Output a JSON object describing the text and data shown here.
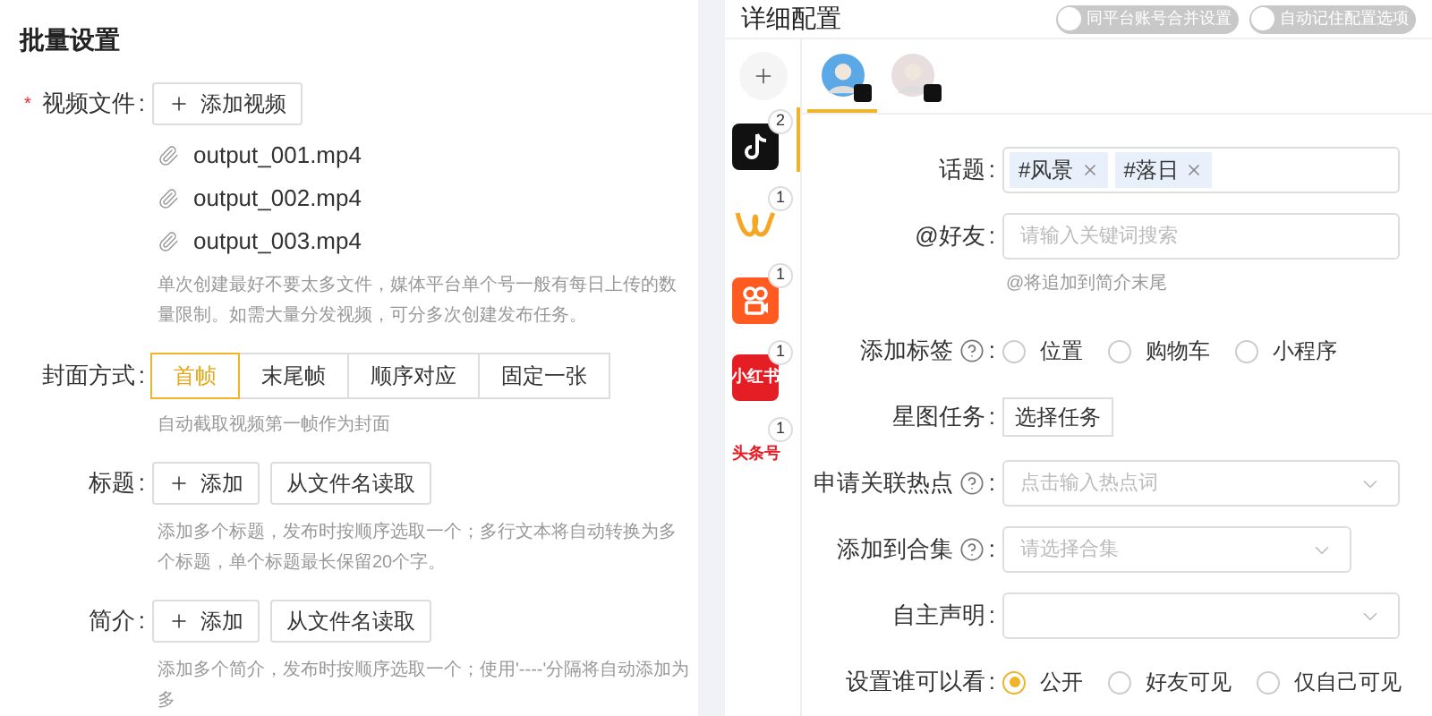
{
  "batch": {
    "title": "批量设置",
    "video": {
      "label": "视频文件",
      "colon": ":",
      "required_mark": "*",
      "button": "添加视频",
      "files": [
        "output_001.mp4",
        "output_002.mp4",
        "output_003.mp4"
      ],
      "hint": "单次创建最好不要太多文件，媒体平台单个号一般有每日上传的数量限制。如需大量分发视频，可分多次创建发布任务。"
    },
    "cover": {
      "label": "封面方式",
      "colon": ":",
      "options": [
        {
          "label": "首帧",
          "selected": true
        },
        {
          "label": "末尾帧",
          "selected": false
        },
        {
          "label": "顺序对应",
          "selected": false
        },
        {
          "label": "固定一张",
          "selected": false
        }
      ],
      "hint": "自动截取视频第一帧作为封面"
    },
    "fields": [
      {
        "label": "标题",
        "colon": ":",
        "add": "添加",
        "read": "从文件名读取",
        "hint": "添加多个标题，发布时按顺序选取一个；多行文本将自动转换为多个标题，单个标题最长保留20个字。"
      },
      {
        "label": "简介",
        "colon": ":",
        "add": "添加",
        "read": "从文件名读取",
        "hint": "添加多个简介，发布时按顺序选取一个；使用'----'分隔将自动添加为多"
      }
    ]
  },
  "detail": {
    "title": "详细配置",
    "toggles": [
      {
        "label": "同平台账号合并设置",
        "on": false
      },
      {
        "label": "自动记住配置选项",
        "on": false
      }
    ],
    "accounts": [
      {
        "selected": true,
        "color": "#5aa9e6"
      },
      {
        "selected": false,
        "color": "#e8dede"
      }
    ],
    "platforms": [
      {
        "kind": "tiktok",
        "count": "2",
        "selected": true
      },
      {
        "kind": "wave",
        "count": "1",
        "selected": false
      },
      {
        "kind": "camera",
        "count": "1",
        "selected": false
      },
      {
        "kind": "xhs",
        "count": "1",
        "selected": false,
        "text": "小红书"
      },
      {
        "kind": "toutiao",
        "count": "1",
        "selected": false,
        "text": "头条号"
      }
    ],
    "rows": [
      {
        "kind": "tags",
        "label": "话题",
        "colon": ":",
        "tags": [
          "#风景",
          "#落日"
        ]
      },
      {
        "kind": "input",
        "label": "@好友",
        "colon": ":",
        "placeholder": "请输入关键词搜索",
        "hint": "@将追加到简介末尾"
      },
      {
        "kind": "radios",
        "label": "添加标签",
        "colon": ":",
        "help": true,
        "options": [
          {
            "label": "位置",
            "selected": false
          },
          {
            "label": "购物车",
            "selected": false
          },
          {
            "label": "小程序",
            "selected": false
          }
        ]
      },
      {
        "kind": "button",
        "label": "星图任务",
        "colon": ":",
        "button": "选择任务"
      },
      {
        "kind": "select",
        "label": "申请关联热点",
        "colon": ":",
        "help": true,
        "placeholder": "点击输入热点词",
        "wide": true
      },
      {
        "kind": "select",
        "label": "添加到合集",
        "colon": ":",
        "help": true,
        "placeholder": "请选择合集",
        "wide": false
      },
      {
        "kind": "select",
        "label": "自主声明",
        "colon": ":",
        "help": false,
        "wide": true
      },
      {
        "kind": "radios",
        "label": "设置谁可以看",
        "colon": ":",
        "help": false,
        "options": [
          {
            "label": "公开",
            "selected": true
          },
          {
            "label": "好友可见",
            "selected": false
          },
          {
            "label": "仅自己可见",
            "selected": false
          }
        ]
      }
    ]
  }
}
